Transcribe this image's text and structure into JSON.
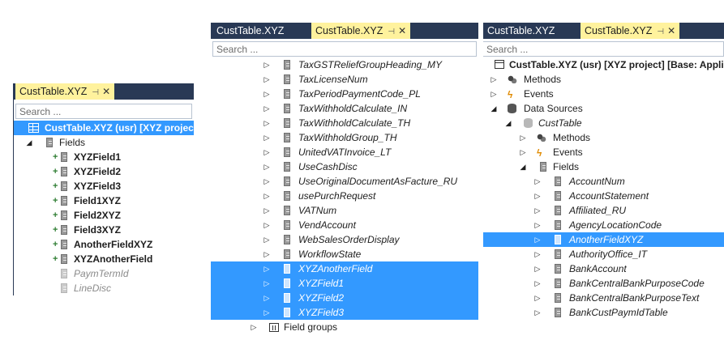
{
  "panel1": {
    "tab_inactive": "",
    "tab_active": "CustTable.XYZ",
    "search_placeholder": "Search ...",
    "root": "CustTable.XYZ (usr) [XYZ project]",
    "fields_label": "Fields",
    "fields": [
      {
        "label": "XYZField1",
        "style": "bold",
        "added": true
      },
      {
        "label": "XYZField2",
        "style": "bold",
        "added": true
      },
      {
        "label": "XYZField3",
        "style": "bold",
        "added": true
      },
      {
        "label": "Field1XYZ",
        "style": "bold",
        "added": true
      },
      {
        "label": "Field2XYZ",
        "style": "bold",
        "added": true
      },
      {
        "label": "Field3XYZ",
        "style": "bold",
        "added": true
      },
      {
        "label": "AnotherFieldXYZ",
        "style": "bold",
        "added": true
      },
      {
        "label": "XYZAnotherField",
        "style": "bold",
        "added": true
      },
      {
        "label": "PaymTermId",
        "style": "dim",
        "added": false
      },
      {
        "label": "LineDisc",
        "style": "dim",
        "added": false
      }
    ]
  },
  "panel2": {
    "tab_inactive": "CustTable.XYZ",
    "tab_active": "CustTable.XYZ",
    "search_placeholder": "Search ...",
    "fields": [
      {
        "label": "TaxGSTReliefGroupHeading_MY",
        "selected": false
      },
      {
        "label": "TaxLicenseNum",
        "selected": false
      },
      {
        "label": "TaxPeriodPaymentCode_PL",
        "selected": false
      },
      {
        "label": "TaxWithholdCalculate_IN",
        "selected": false
      },
      {
        "label": "TaxWithholdCalculate_TH",
        "selected": false
      },
      {
        "label": "TaxWithholdGroup_TH",
        "selected": false
      },
      {
        "label": "UnitedVATInvoice_LT",
        "selected": false
      },
      {
        "label": "UseCashDisc",
        "selected": false
      },
      {
        "label": "UseOriginalDocumentAsFacture_RU",
        "selected": false
      },
      {
        "label": "usePurchRequest",
        "selected": false
      },
      {
        "label": "VATNum",
        "selected": false
      },
      {
        "label": "VendAccount",
        "selected": false
      },
      {
        "label": "WebSalesOrderDisplay",
        "selected": false
      },
      {
        "label": "WorkflowState",
        "selected": false
      },
      {
        "label": "XYZAnotherField",
        "selected": true
      },
      {
        "label": "XYZField1",
        "selected": true
      },
      {
        "label": "XYZField2",
        "selected": true
      },
      {
        "label": "XYZField3",
        "selected": true
      }
    ],
    "field_groups_label": "Field groups"
  },
  "panel3": {
    "tab_inactive": "CustTable.XYZ",
    "tab_active": "CustTable.XYZ",
    "search_placeholder": "Search ...",
    "root": "CustTable.XYZ (usr) [XYZ project] [Base: Appli",
    "methods_label": "Methods",
    "events_label": "Events",
    "datasources_label": "Data Sources",
    "custtable_label": "CustTable",
    "ds_methods_label": "Methods",
    "ds_events_label": "Events",
    "ds_fields_label": "Fields",
    "fields": [
      {
        "label": "AccountNum",
        "selected": false
      },
      {
        "label": "AccountStatement",
        "selected": false
      },
      {
        "label": "Affiliated_RU",
        "selected": false
      },
      {
        "label": "AgencyLocationCode",
        "selected": false
      },
      {
        "label": "AnotherFieldXYZ",
        "selected": true
      },
      {
        "label": "AuthorityOffice_IT",
        "selected": false
      },
      {
        "label": "BankAccount",
        "selected": false
      },
      {
        "label": "BankCentralBankPurposeCode",
        "selected": false
      },
      {
        "label": "BankCentralBankPurposeText",
        "selected": false
      },
      {
        "label": "BankCustPaymIdTable",
        "selected": false
      }
    ]
  }
}
